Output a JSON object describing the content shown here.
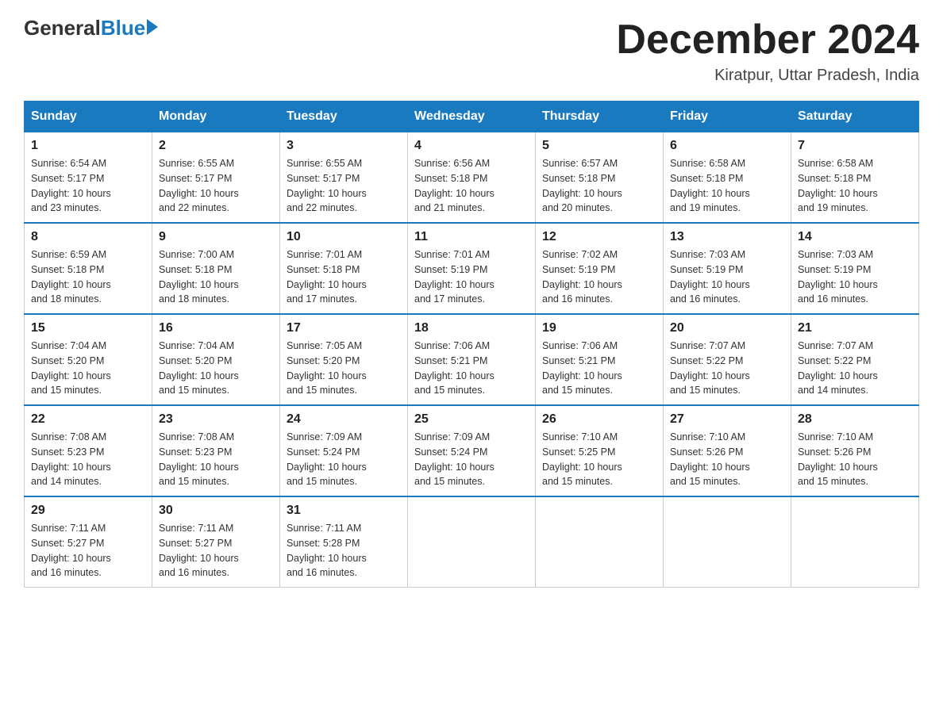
{
  "header": {
    "logo": {
      "general": "General",
      "blue": "Blue"
    },
    "title": "December 2024",
    "location": "Kiratpur, Uttar Pradesh, India"
  },
  "days_of_week": [
    "Sunday",
    "Monday",
    "Tuesday",
    "Wednesday",
    "Thursday",
    "Friday",
    "Saturday"
  ],
  "weeks": [
    [
      {
        "day": 1,
        "sunrise": "6:54 AM",
        "sunset": "5:17 PM",
        "daylight": "10 hours and 23 minutes."
      },
      {
        "day": 2,
        "sunrise": "6:55 AM",
        "sunset": "5:17 PM",
        "daylight": "10 hours and 22 minutes."
      },
      {
        "day": 3,
        "sunrise": "6:55 AM",
        "sunset": "5:17 PM",
        "daylight": "10 hours and 22 minutes."
      },
      {
        "day": 4,
        "sunrise": "6:56 AM",
        "sunset": "5:18 PM",
        "daylight": "10 hours and 21 minutes."
      },
      {
        "day": 5,
        "sunrise": "6:57 AM",
        "sunset": "5:18 PM",
        "daylight": "10 hours and 20 minutes."
      },
      {
        "day": 6,
        "sunrise": "6:58 AM",
        "sunset": "5:18 PM",
        "daylight": "10 hours and 19 minutes."
      },
      {
        "day": 7,
        "sunrise": "6:58 AM",
        "sunset": "5:18 PM",
        "daylight": "10 hours and 19 minutes."
      }
    ],
    [
      {
        "day": 8,
        "sunrise": "6:59 AM",
        "sunset": "5:18 PM",
        "daylight": "10 hours and 18 minutes."
      },
      {
        "day": 9,
        "sunrise": "7:00 AM",
        "sunset": "5:18 PM",
        "daylight": "10 hours and 18 minutes."
      },
      {
        "day": 10,
        "sunrise": "7:01 AM",
        "sunset": "5:18 PM",
        "daylight": "10 hours and 17 minutes."
      },
      {
        "day": 11,
        "sunrise": "7:01 AM",
        "sunset": "5:19 PM",
        "daylight": "10 hours and 17 minutes."
      },
      {
        "day": 12,
        "sunrise": "7:02 AM",
        "sunset": "5:19 PM",
        "daylight": "10 hours and 16 minutes."
      },
      {
        "day": 13,
        "sunrise": "7:03 AM",
        "sunset": "5:19 PM",
        "daylight": "10 hours and 16 minutes."
      },
      {
        "day": 14,
        "sunrise": "7:03 AM",
        "sunset": "5:19 PM",
        "daylight": "10 hours and 16 minutes."
      }
    ],
    [
      {
        "day": 15,
        "sunrise": "7:04 AM",
        "sunset": "5:20 PM",
        "daylight": "10 hours and 15 minutes."
      },
      {
        "day": 16,
        "sunrise": "7:04 AM",
        "sunset": "5:20 PM",
        "daylight": "10 hours and 15 minutes."
      },
      {
        "day": 17,
        "sunrise": "7:05 AM",
        "sunset": "5:20 PM",
        "daylight": "10 hours and 15 minutes."
      },
      {
        "day": 18,
        "sunrise": "7:06 AM",
        "sunset": "5:21 PM",
        "daylight": "10 hours and 15 minutes."
      },
      {
        "day": 19,
        "sunrise": "7:06 AM",
        "sunset": "5:21 PM",
        "daylight": "10 hours and 15 minutes."
      },
      {
        "day": 20,
        "sunrise": "7:07 AM",
        "sunset": "5:22 PM",
        "daylight": "10 hours and 15 minutes."
      },
      {
        "day": 21,
        "sunrise": "7:07 AM",
        "sunset": "5:22 PM",
        "daylight": "10 hours and 14 minutes."
      }
    ],
    [
      {
        "day": 22,
        "sunrise": "7:08 AM",
        "sunset": "5:23 PM",
        "daylight": "10 hours and 14 minutes."
      },
      {
        "day": 23,
        "sunrise": "7:08 AM",
        "sunset": "5:23 PM",
        "daylight": "10 hours and 15 minutes."
      },
      {
        "day": 24,
        "sunrise": "7:09 AM",
        "sunset": "5:24 PM",
        "daylight": "10 hours and 15 minutes."
      },
      {
        "day": 25,
        "sunrise": "7:09 AM",
        "sunset": "5:24 PM",
        "daylight": "10 hours and 15 minutes."
      },
      {
        "day": 26,
        "sunrise": "7:10 AM",
        "sunset": "5:25 PM",
        "daylight": "10 hours and 15 minutes."
      },
      {
        "day": 27,
        "sunrise": "7:10 AM",
        "sunset": "5:26 PM",
        "daylight": "10 hours and 15 minutes."
      },
      {
        "day": 28,
        "sunrise": "7:10 AM",
        "sunset": "5:26 PM",
        "daylight": "10 hours and 15 minutes."
      }
    ],
    [
      {
        "day": 29,
        "sunrise": "7:11 AM",
        "sunset": "5:27 PM",
        "daylight": "10 hours and 16 minutes."
      },
      {
        "day": 30,
        "sunrise": "7:11 AM",
        "sunset": "5:27 PM",
        "daylight": "10 hours and 16 minutes."
      },
      {
        "day": 31,
        "sunrise": "7:11 AM",
        "sunset": "5:28 PM",
        "daylight": "10 hours and 16 minutes."
      },
      null,
      null,
      null,
      null
    ]
  ],
  "labels": {
    "sunrise": "Sunrise:",
    "sunset": "Sunset:",
    "daylight": "Daylight:"
  }
}
